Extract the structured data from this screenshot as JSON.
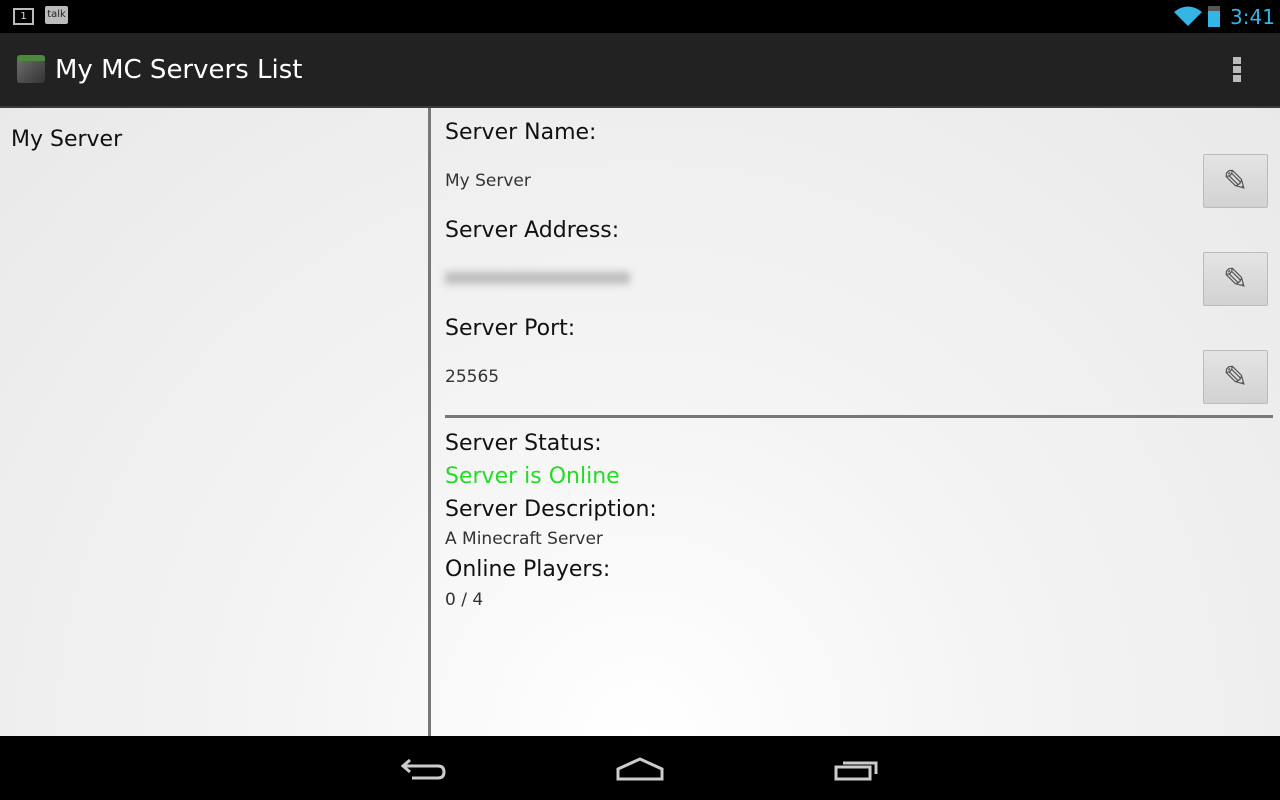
{
  "status_bar": {
    "notif_count": "1",
    "talk_label": "talk",
    "time": "3:41",
    "accent": "#33b5e5"
  },
  "app_bar": {
    "title": "My MC Servers List",
    "menu_icon": "overflow-menu-icon"
  },
  "server_list": [
    {
      "name": "My Server"
    }
  ],
  "details": {
    "name_label": "Server Name:",
    "name_value": "My Server",
    "address_label": "Server Address:",
    "port_label": "Server Port:",
    "port_value": "25565",
    "status_label": "Server Status:",
    "status_value": "Server is Online",
    "status_color": "#22dd22",
    "description_label": "Server Description:",
    "description_value": "A Minecraft Server",
    "players_label": "Online Players:",
    "players_value": "0 / 4"
  }
}
